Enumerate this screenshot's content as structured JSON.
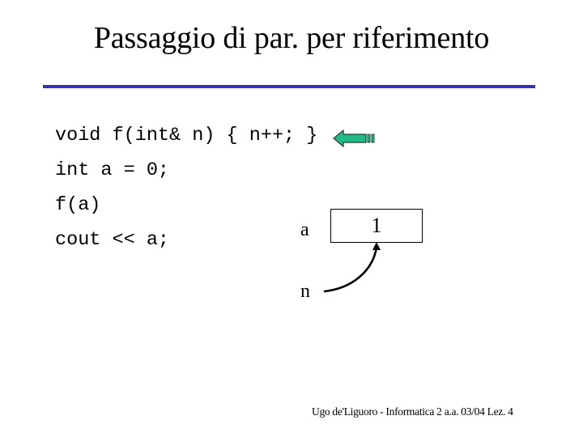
{
  "slide": {
    "title": "Passaggio di par. per riferimento",
    "accent_color": "#3333aa",
    "code_lines": [
      "void f(int& n) { n++; }",
      "int a = 0;",
      "f(a)",
      "cout << a;"
    ],
    "pointer_arrow": {
      "icon": "left-arrow-icon",
      "color": "#22bb88",
      "points_to_line": 0
    },
    "diagram": {
      "variable_label": "a",
      "variable_value": "1",
      "reference_label": "n"
    },
    "footer": "Ugo de'Liguoro - Informatica 2 a.a. 03/04 Lez. 4"
  }
}
